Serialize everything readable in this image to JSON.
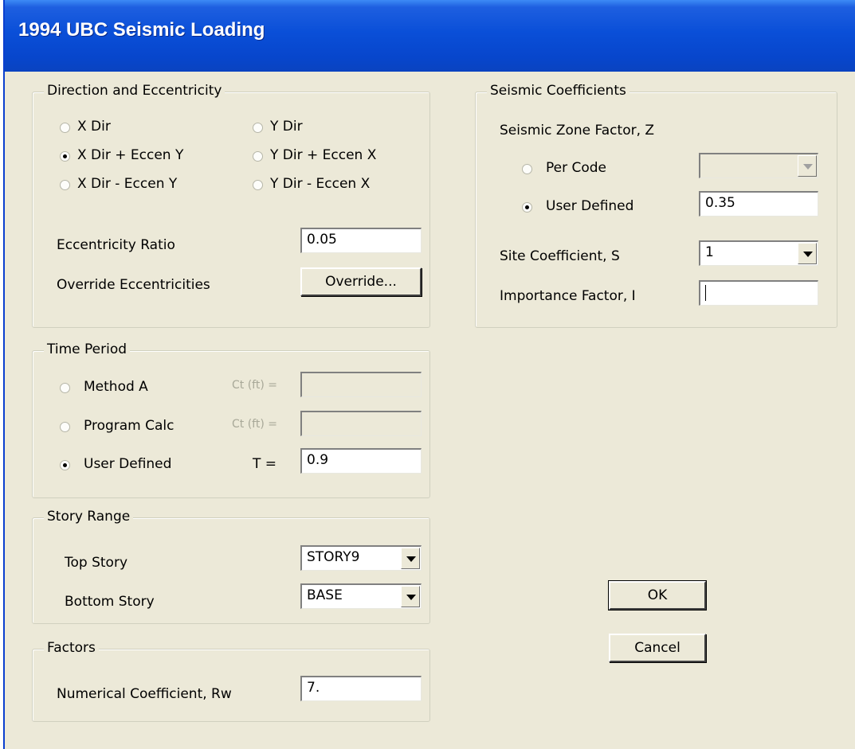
{
  "window": {
    "title": "1994 UBC Seismic Loading"
  },
  "direction": {
    "label": "Direction and Eccentricity",
    "options": [
      "X Dir",
      "Y Dir",
      "X Dir + Eccen Y",
      "Y Dir + Eccen X",
      "X Dir - Eccen Y",
      "Y Dir - Eccen X"
    ],
    "selected": "X Dir + Eccen Y",
    "ecc_ratio_label": "Eccentricity Ratio",
    "ecc_ratio_value": "0.05",
    "override_label": "Override Eccentricities",
    "override_button": "Override..."
  },
  "time_period": {
    "label": "Time Period",
    "method_a": "Method A",
    "program_calc": "Program Calc",
    "user_defined": "User Defined",
    "ct_label": "Ct (ft) =",
    "t_label": "T =",
    "t_value": "0.9",
    "selected": "User Defined"
  },
  "story_range": {
    "label": "Story Range",
    "top_label": "Top Story",
    "top_value": "STORY9",
    "bottom_label": "Bottom Story",
    "bottom_value": "BASE"
  },
  "factors": {
    "label": "Factors",
    "rw_label": "Numerical Coefficient, Rw",
    "rw_value": "7."
  },
  "seismic": {
    "label": "Seismic Coefficients",
    "zone_label": "Seismic Zone Factor, Z",
    "per_code": "Per Code",
    "user_defined": "User Defined",
    "zone_value": "0.35",
    "site_label": "Site Coefficient, S",
    "site_value": "1",
    "importance_label": "Importance Factor, I",
    "importance_value": ""
  },
  "buttons": {
    "ok": "OK",
    "cancel": "Cancel"
  }
}
